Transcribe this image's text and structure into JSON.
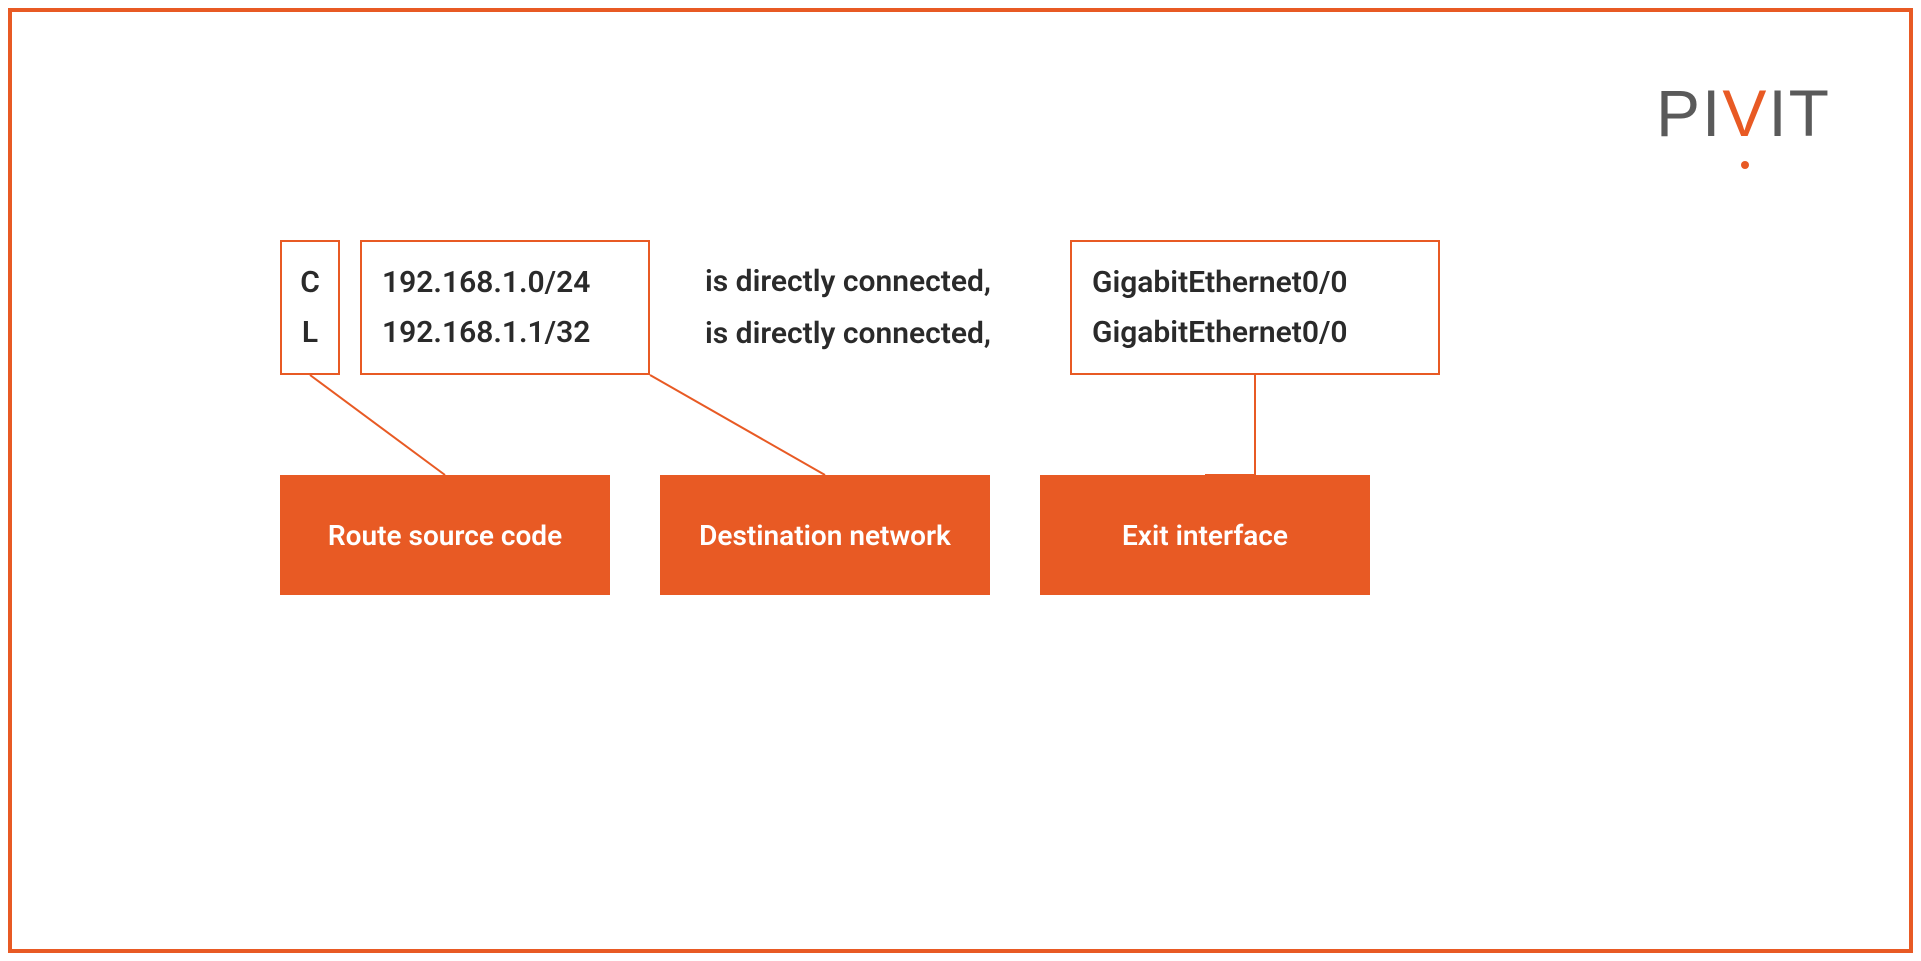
{
  "logo": {
    "part1": "PI",
    "accent": "V",
    "part2": "IT"
  },
  "routes": [
    {
      "code": "C",
      "network": "192.168.1.0/24",
      "connected": "is directly connected,",
      "interface": "GigabitEthernet0/0"
    },
    {
      "code": "L",
      "network": "192.168.1.1/32",
      "connected": "is directly connected,",
      "interface": "GigabitEthernet0/0"
    }
  ],
  "labels": {
    "route_source": "Route source code",
    "destination": "Destination network",
    "exit": "Exit interface"
  }
}
